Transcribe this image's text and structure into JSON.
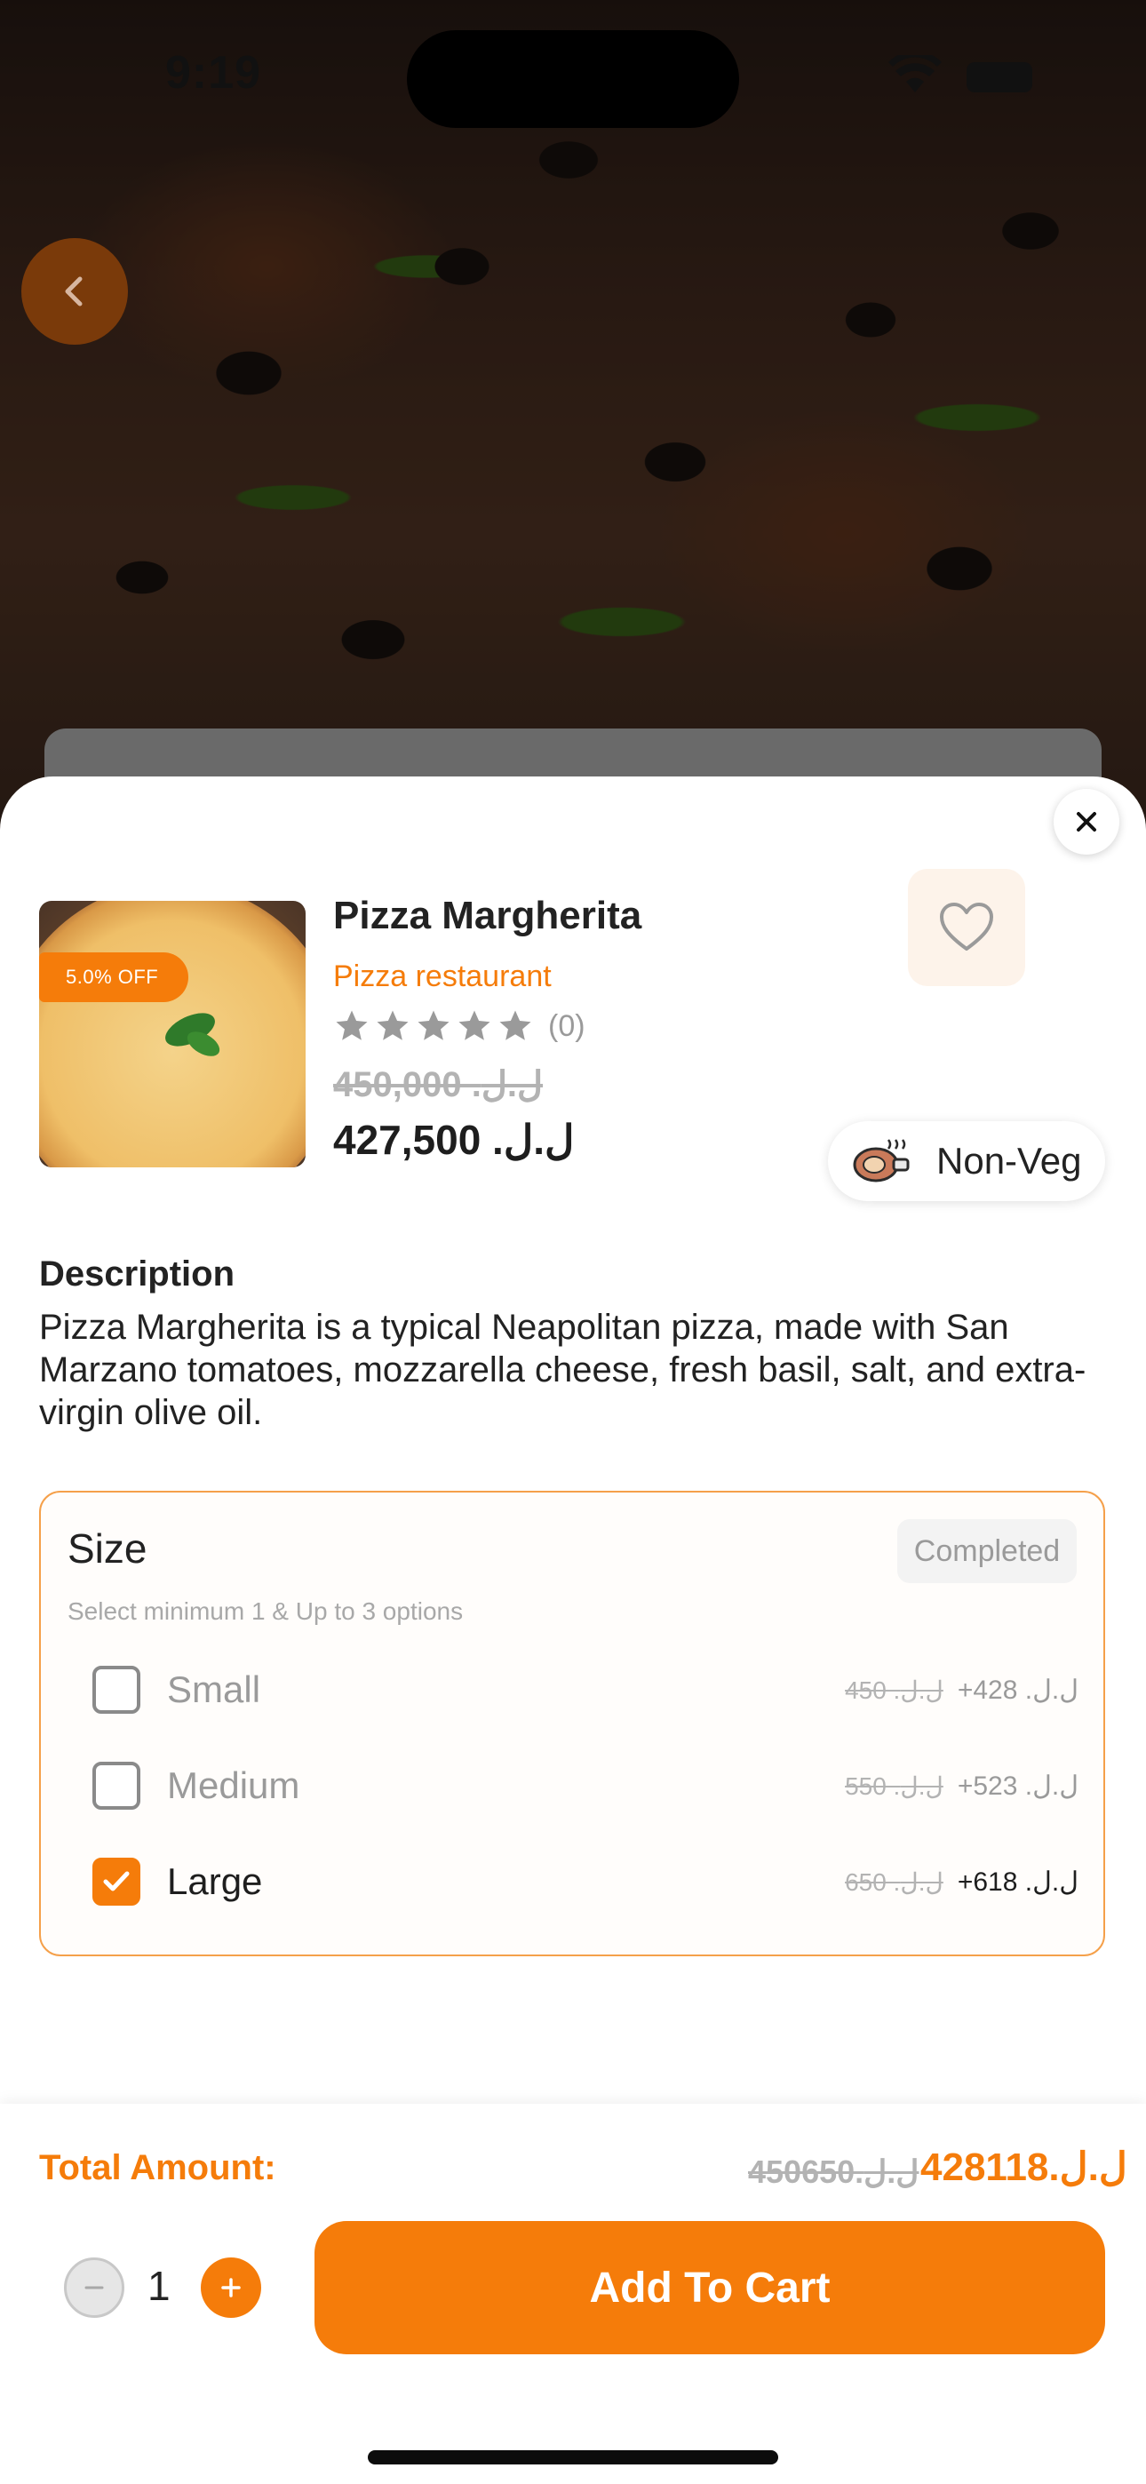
{
  "status_bar": {
    "time": "9:19"
  },
  "product": {
    "title": "Pizza Margherita",
    "restaurant": "Pizza restaurant",
    "rating_count": "(0)",
    "rating_value": 0,
    "rating_max": 5,
    "old_price": "450,000 .ل.ل",
    "new_price": "427,500 .ل.ل",
    "discount_badge": "5.0% OFF",
    "diet_tag": "Non-Veg"
  },
  "description": {
    "title": "Description",
    "text": "Pizza Margherita is a typical Neapolitan pizza, made with San Marzano tomatoes, mozzarella cheese, fresh basil, salt, and extra-virgin olive oil."
  },
  "size": {
    "title": "Size",
    "status": "Completed",
    "subtitle": "Select minimum 1 & Up to 3 options",
    "options": [
      {
        "name": "Small",
        "old_price": "450 .ل.ل",
        "new_price": "+428 .ل.ل",
        "checked": false
      },
      {
        "name": "Medium",
        "old_price": "550 .ل.ل",
        "new_price": "+523 .ل.ل",
        "checked": false
      },
      {
        "name": "Large",
        "old_price": "650 .ل.ل",
        "new_price": "+618 .ل.ل",
        "checked": true
      }
    ]
  },
  "footer": {
    "total_label": "Total Amount:",
    "total_old": "450650.ل.ل",
    "total_new": "428118.ل.ل",
    "quantity": "1",
    "add_to_cart": "Add To Cart"
  },
  "colors": {
    "accent": "#f57c0a",
    "muted": "#9a9a9a"
  },
  "icons": [
    "back-icon",
    "close-icon",
    "heart-icon",
    "star-icon",
    "non-veg-icon",
    "checkbox-icon",
    "minus-icon",
    "plus-icon"
  ]
}
